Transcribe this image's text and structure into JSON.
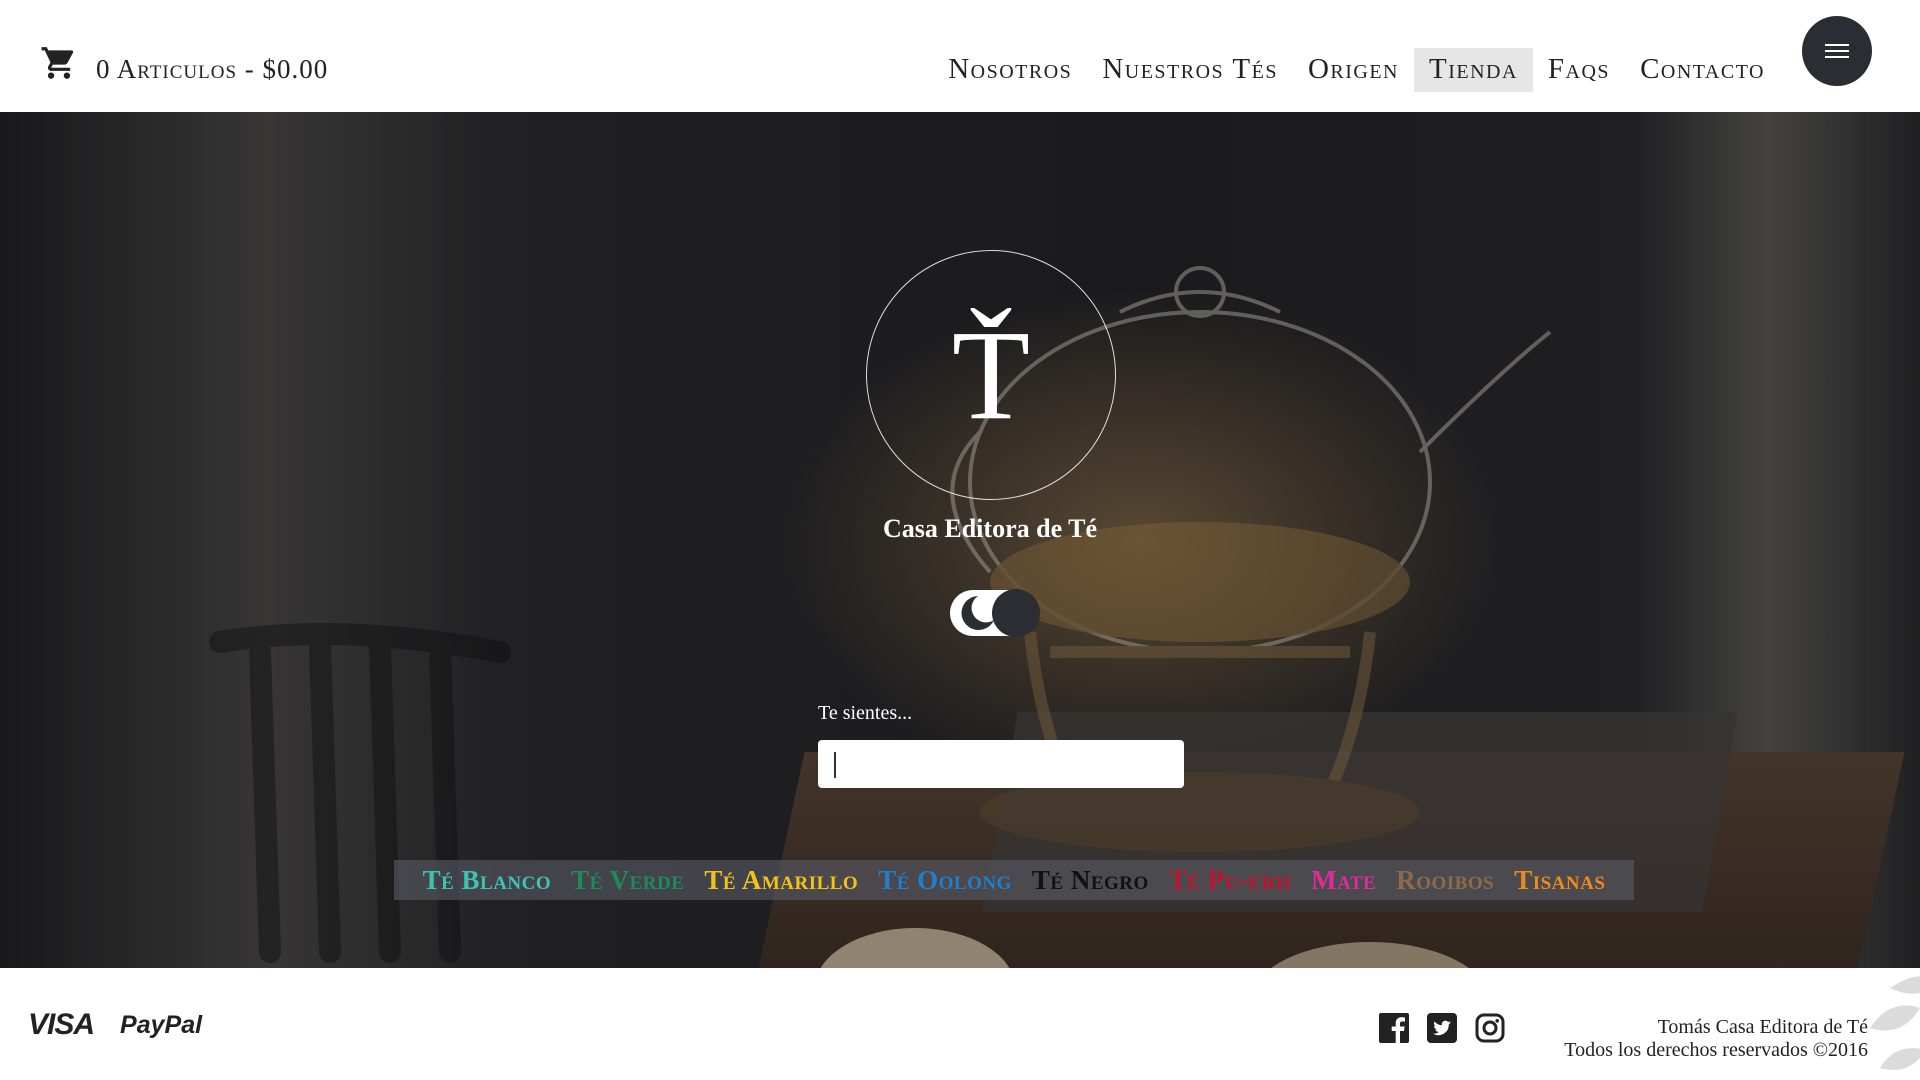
{
  "header": {
    "cart": {
      "icon": "shopping-cart-icon",
      "text": "0 Articulos - $0.00"
    },
    "nav": [
      {
        "label": "Nosotros",
        "active": false
      },
      {
        "label": "Nuestros Tés",
        "active": false
      },
      {
        "label": "Origen",
        "active": false
      },
      {
        "label": "Tienda",
        "active": true
      },
      {
        "label": "Faqs",
        "active": false
      },
      {
        "label": "Contacto",
        "active": false
      }
    ],
    "menu_icon": "hamburger-menu-icon"
  },
  "hero": {
    "logo_letter": "Ť",
    "brand": "Casa Editora de Té",
    "toggle_icon": "moon-icon",
    "feel_label": "Te sientes...",
    "feel_value": "",
    "categories": [
      {
        "label": "Té Blanco",
        "color": "#3cc3b4"
      },
      {
        "label": "Té Verde",
        "color": "#1f8a5a"
      },
      {
        "label": "Té Amarillo",
        "color": "#f2c21b"
      },
      {
        "label": "Té Oolong",
        "color": "#1d7fd0"
      },
      {
        "label": "Té Negro",
        "color": "#111111"
      },
      {
        "label": "Té Pu-erh",
        "color": "#c0142e"
      },
      {
        "label": "Mate",
        "color": "#e12a9a"
      },
      {
        "label": "Rooibos",
        "color": "#8d6a4c"
      },
      {
        "label": "Tisanas",
        "color": "#ef8a1c"
      }
    ]
  },
  "footer": {
    "payments": {
      "visa": "VISA",
      "paypal": "PayPal"
    },
    "social": [
      "facebook-icon",
      "twitter-icon",
      "instagram-icon"
    ],
    "copyright_line1": "Tomás Casa Editora de Té",
    "copyright_line2": "Todos los derechos reservados ©2016"
  }
}
